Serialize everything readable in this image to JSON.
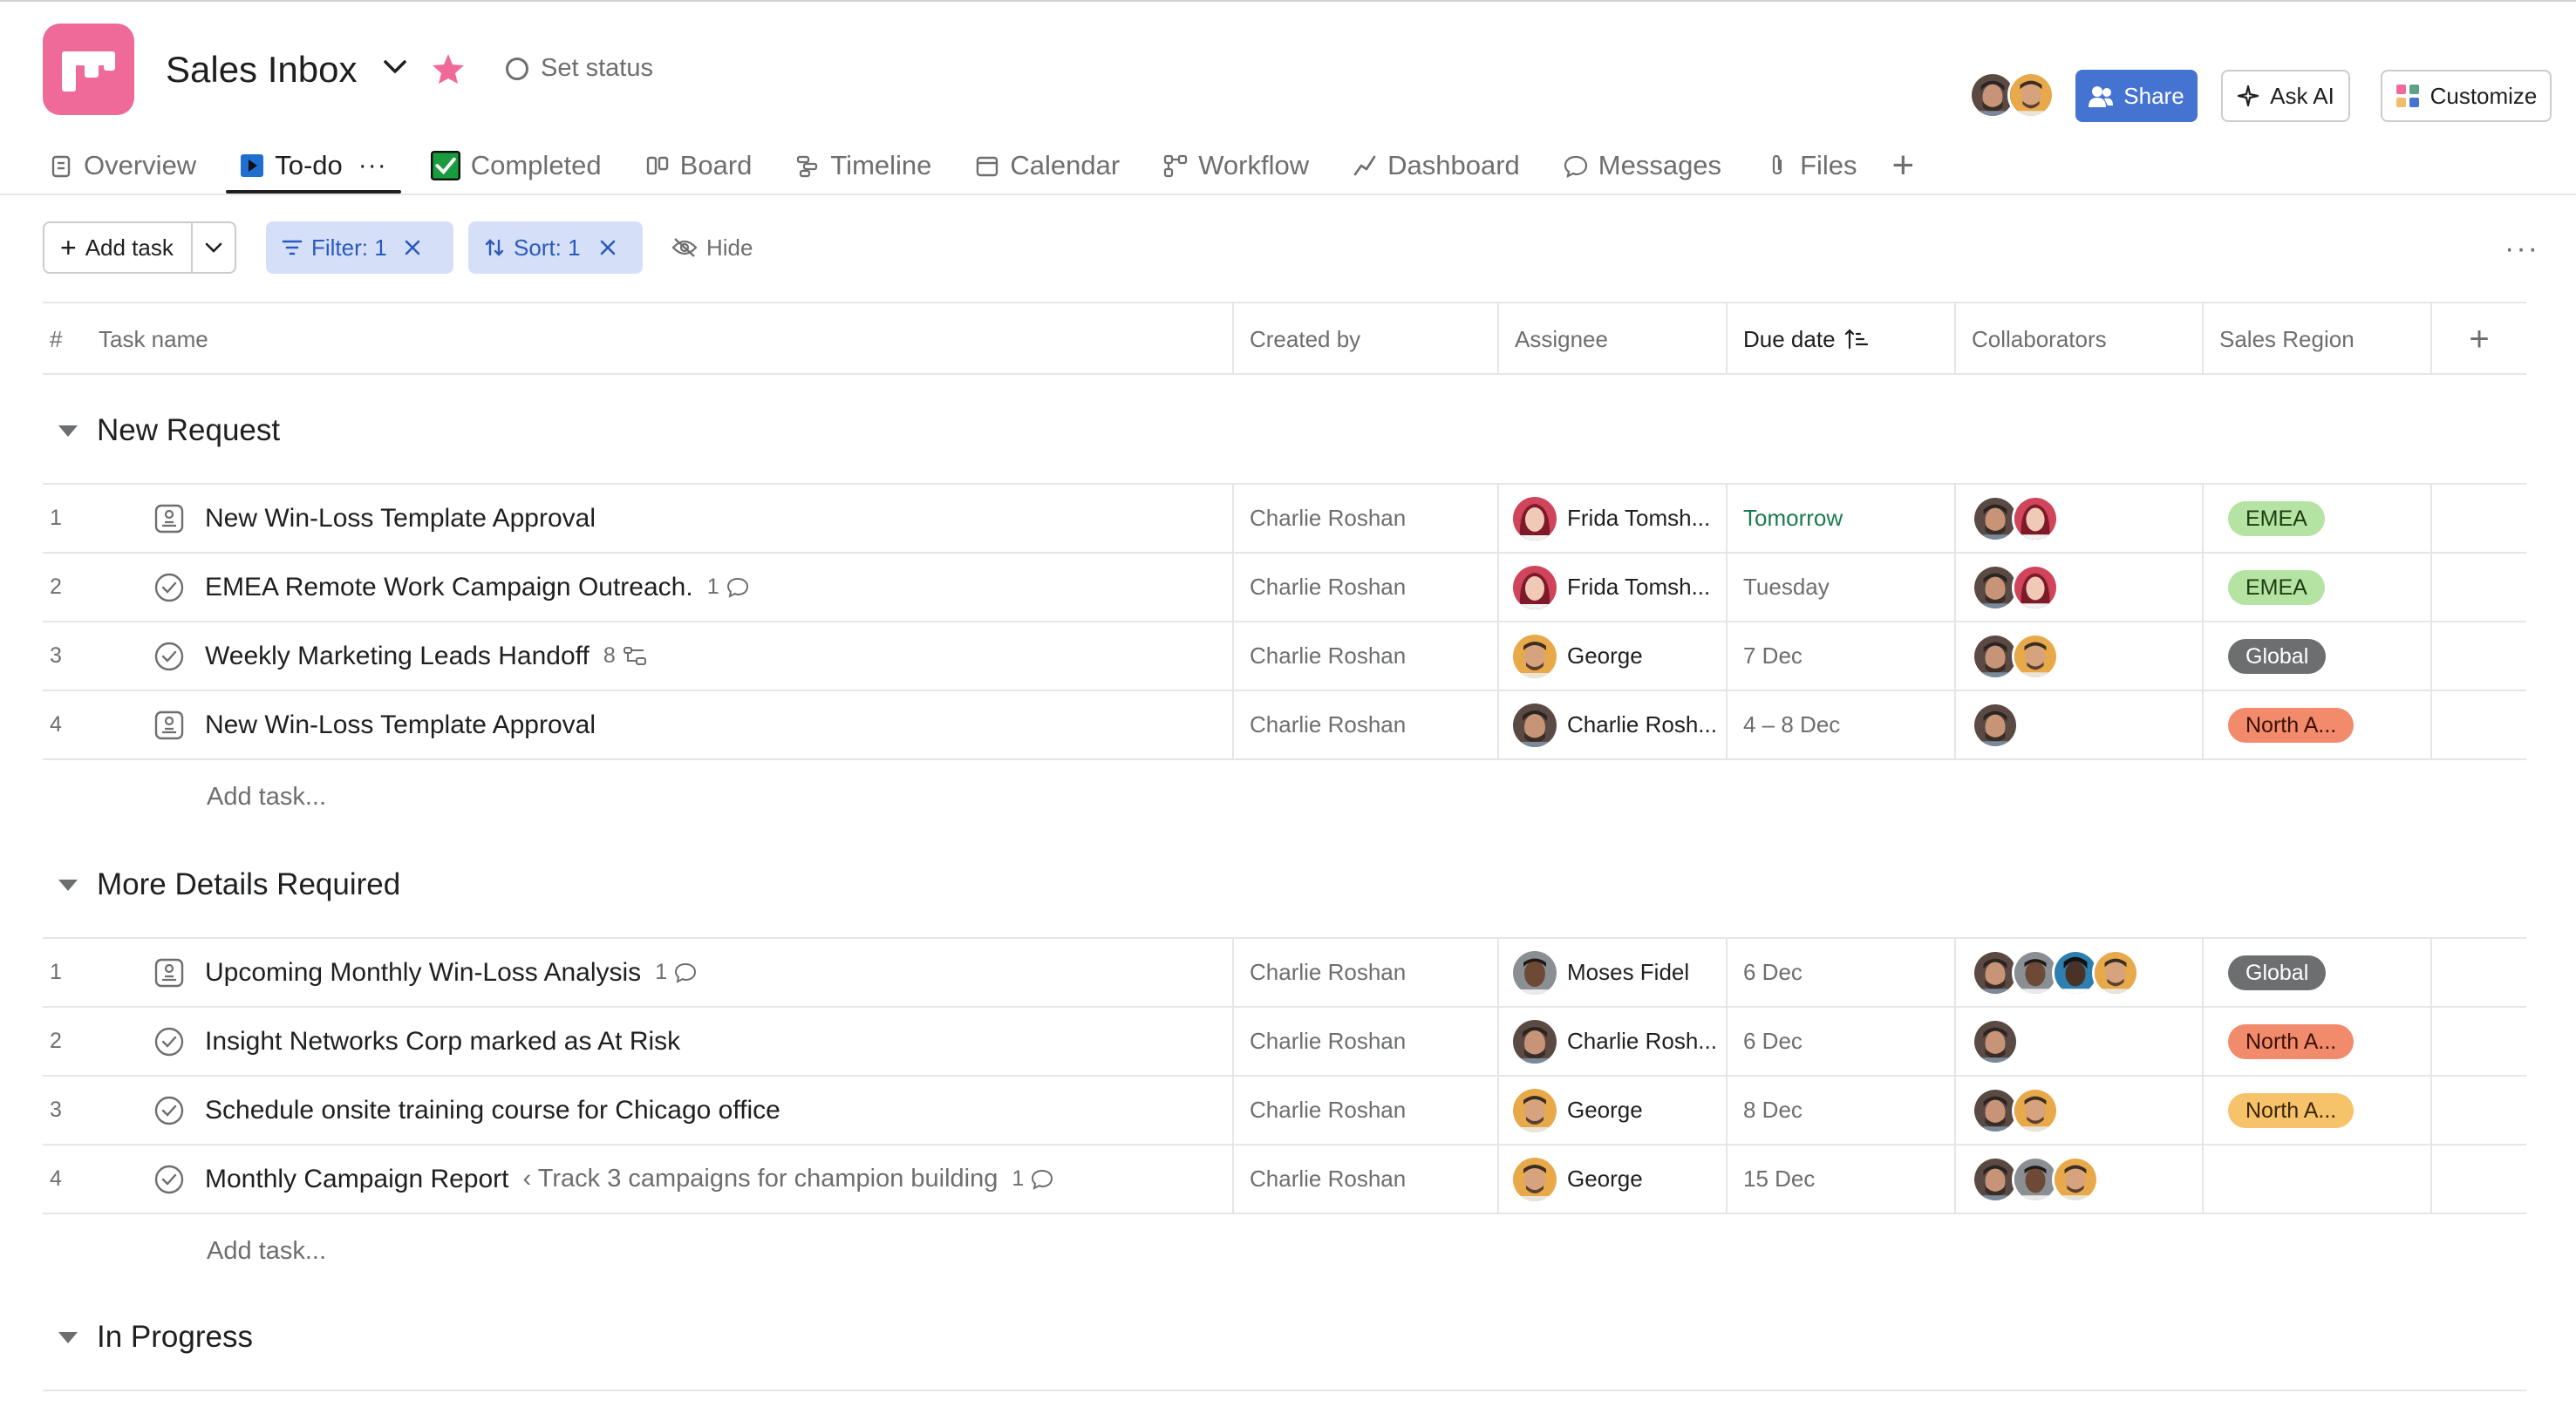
{
  "header": {
    "project_title": "Sales Inbox",
    "status_label": "Set status",
    "share_label": "Share",
    "ask_ai_label": "Ask AI",
    "customize_label": "Customize"
  },
  "tabs": [
    {
      "label": "Overview",
      "icon": "overview-icon"
    },
    {
      "label": "To-do",
      "icon": "list-icon",
      "active": true
    },
    {
      "label": "Completed",
      "icon": "checkbox-icon"
    },
    {
      "label": "Board",
      "icon": "board-icon"
    },
    {
      "label": "Timeline",
      "icon": "timeline-icon"
    },
    {
      "label": "Calendar",
      "icon": "calendar-icon"
    },
    {
      "label": "Workflow",
      "icon": "workflow-icon"
    },
    {
      "label": "Dashboard",
      "icon": "dashboard-icon"
    },
    {
      "label": "Messages",
      "icon": "message-icon"
    },
    {
      "label": "Files",
      "icon": "paperclip-icon"
    }
  ],
  "toolbar": {
    "add_task_label": "Add task",
    "filter_label": "Filter: 1",
    "sort_label": "Sort: 1",
    "hide_label": "Hide"
  },
  "columns": {
    "hash": "#",
    "task_name": "Task name",
    "created_by": "Created by",
    "assignee": "Assignee",
    "due_date": "Due date",
    "collaborators": "Collaborators",
    "sales_region": "Sales Region"
  },
  "colors": {
    "accent_blue": "#4573d2",
    "brand_pink": "#f06a99",
    "star_pink": "#f06a99",
    "chip_bg": "#d5e0f8",
    "due_green": "#1b7a4f"
  },
  "sections": [
    {
      "title": "New Request",
      "add_task_label": "Add task...",
      "tasks": [
        {
          "num": "1",
          "icon": "approval-icon",
          "name": "New Win-Loss Template Approval",
          "meta": "",
          "created_by": "Charlie Roshan",
          "assignee": "Frida Tomsh...",
          "due": "Tomorrow",
          "region": "EMEA"
        },
        {
          "num": "2",
          "icon": "check-circle-icon",
          "name": "EMEA Remote Work Campaign Outreach.",
          "meta": "1",
          "created_by": "Charlie Roshan",
          "assignee": "Frida Tomsh...",
          "due": "Tuesday",
          "region": "EMEA"
        },
        {
          "num": "3",
          "icon": "check-circle-icon",
          "name": "Weekly Marketing Leads Handoff",
          "meta": "8",
          "created_by": "Charlie Roshan",
          "assignee": "George",
          "due": "7 Dec",
          "region": "Global"
        },
        {
          "num": "4",
          "icon": "approval-icon",
          "name": "New Win-Loss Template Approval",
          "meta": "",
          "created_by": "Charlie Roshan",
          "assignee": "Charlie Rosh...",
          "due": "4 – 8 Dec",
          "region": "North A..."
        }
      ]
    },
    {
      "title": "More Details Required",
      "add_task_label": "Add task...",
      "tasks": [
        {
          "num": "1",
          "icon": "approval-icon",
          "name": "Upcoming Monthly Win-Loss Analysis",
          "meta": "1",
          "created_by": "Charlie Roshan",
          "assignee": "Moses Fidel",
          "due": "6 Dec",
          "region": "Global"
        },
        {
          "num": "2",
          "icon": "check-circle-icon",
          "name": "Insight Networks Corp marked as At Risk",
          "meta": "",
          "created_by": "Charlie Roshan",
          "assignee": "Charlie Rosh...",
          "due": "6 Dec",
          "region": "North A..."
        },
        {
          "num": "3",
          "icon": "check-circle-icon",
          "name": "Schedule onsite training course for Chicago office",
          "meta": "",
          "created_by": "Charlie Roshan",
          "assignee": "George",
          "due": "8 Dec",
          "region": "North A..."
        },
        {
          "num": "4",
          "icon": "check-circle-icon",
          "name": "Monthly Campaign Report",
          "parent": "Track 3 campaigns for champion building",
          "meta": "1",
          "created_by": "Charlie Roshan",
          "assignee": "George",
          "due": "15 Dec",
          "region": ""
        }
      ]
    },
    {
      "title": "In Progress"
    }
  ]
}
